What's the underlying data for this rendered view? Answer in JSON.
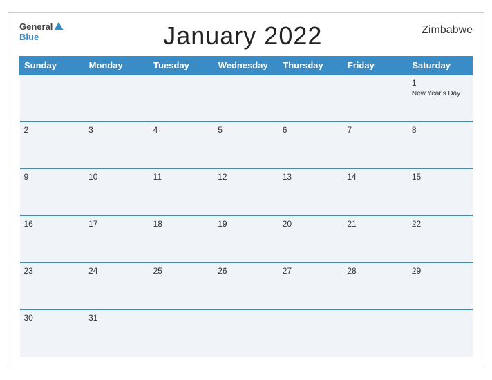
{
  "header": {
    "logo_general": "General",
    "logo_blue": "Blue",
    "title": "January 2022",
    "country": "Zimbabwe"
  },
  "days_of_week": [
    "Sunday",
    "Monday",
    "Tuesday",
    "Wednesday",
    "Thursday",
    "Friday",
    "Saturday"
  ],
  "weeks": [
    [
      {
        "day": "",
        "holiday": ""
      },
      {
        "day": "",
        "holiday": ""
      },
      {
        "day": "",
        "holiday": ""
      },
      {
        "day": "",
        "holiday": ""
      },
      {
        "day": "",
        "holiday": ""
      },
      {
        "day": "",
        "holiday": ""
      },
      {
        "day": "1",
        "holiday": "New Year's Day"
      }
    ],
    [
      {
        "day": "2",
        "holiday": ""
      },
      {
        "day": "3",
        "holiday": ""
      },
      {
        "day": "4",
        "holiday": ""
      },
      {
        "day": "5",
        "holiday": ""
      },
      {
        "day": "6",
        "holiday": ""
      },
      {
        "day": "7",
        "holiday": ""
      },
      {
        "day": "8",
        "holiday": ""
      }
    ],
    [
      {
        "day": "9",
        "holiday": ""
      },
      {
        "day": "10",
        "holiday": ""
      },
      {
        "day": "11",
        "holiday": ""
      },
      {
        "day": "12",
        "holiday": ""
      },
      {
        "day": "13",
        "holiday": ""
      },
      {
        "day": "14",
        "holiday": ""
      },
      {
        "day": "15",
        "holiday": ""
      }
    ],
    [
      {
        "day": "16",
        "holiday": ""
      },
      {
        "day": "17",
        "holiday": ""
      },
      {
        "day": "18",
        "holiday": ""
      },
      {
        "day": "19",
        "holiday": ""
      },
      {
        "day": "20",
        "holiday": ""
      },
      {
        "day": "21",
        "holiday": ""
      },
      {
        "day": "22",
        "holiday": ""
      }
    ],
    [
      {
        "day": "23",
        "holiday": ""
      },
      {
        "day": "24",
        "holiday": ""
      },
      {
        "day": "25",
        "holiday": ""
      },
      {
        "day": "26",
        "holiday": ""
      },
      {
        "day": "27",
        "holiday": ""
      },
      {
        "day": "28",
        "holiday": ""
      },
      {
        "day": "29",
        "holiday": ""
      }
    ],
    [
      {
        "day": "30",
        "holiday": ""
      },
      {
        "day": "31",
        "holiday": ""
      },
      {
        "day": "",
        "holiday": ""
      },
      {
        "day": "",
        "holiday": ""
      },
      {
        "day": "",
        "holiday": ""
      },
      {
        "day": "",
        "holiday": ""
      },
      {
        "day": "",
        "holiday": ""
      }
    ]
  ],
  "colors": {
    "header_bg": "#3a8cc7",
    "cell_bg": "#f0f4f8",
    "row_border": "#3a8cc7"
  }
}
